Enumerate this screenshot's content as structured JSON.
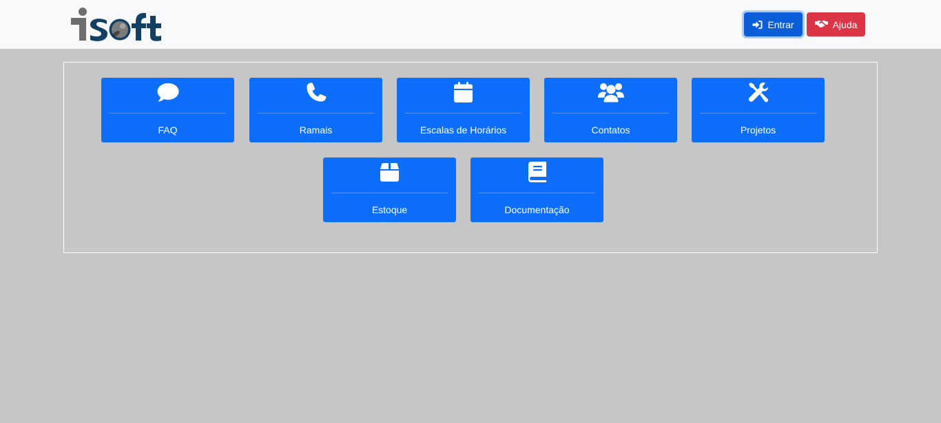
{
  "header": {
    "logo_text": "isoft",
    "login_label": "Entrar",
    "help_label": "Ajuda"
  },
  "tiles": [
    {
      "label": "FAQ",
      "icon": "comment-icon"
    },
    {
      "label": "Ramais",
      "icon": "phone-icon"
    },
    {
      "label": "Escalas de Horários",
      "icon": "calendar-icon"
    },
    {
      "label": "Contatos",
      "icon": "users-icon"
    },
    {
      "label": "Projetos",
      "icon": "tools-icon"
    },
    {
      "label": "Estoque",
      "icon": "box-icon"
    },
    {
      "label": "Documentação",
      "icon": "book-icon"
    }
  ],
  "colors": {
    "page_background": "#c6c6c6",
    "navbar_background": "#f8f9fb",
    "tile_blue": "#0d6efd",
    "login_blue": "#0b5ed7",
    "help_red": "#dc3545",
    "logo_grey": "#6d6d6d",
    "logo_navy": "#123f63"
  }
}
